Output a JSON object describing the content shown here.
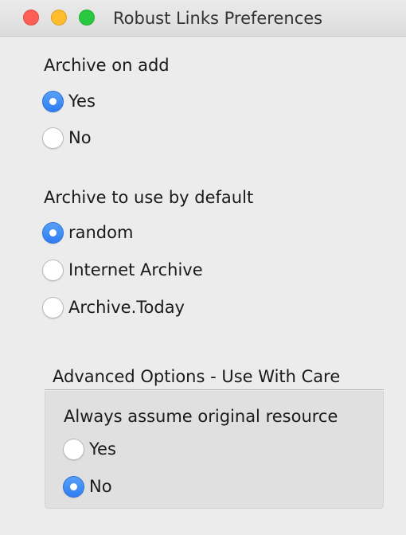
{
  "window": {
    "title": "Robust Links Preferences"
  },
  "archive_on_add": {
    "label": "Archive on add",
    "options": [
      {
        "label": "Yes",
        "checked": true
      },
      {
        "label": "No",
        "checked": false
      }
    ]
  },
  "default_archive": {
    "label": "Archive to use by default",
    "options": [
      {
        "label": "random",
        "checked": true
      },
      {
        "label": "Internet Archive",
        "checked": false
      },
      {
        "label": "Archive.Today",
        "checked": false
      }
    ]
  },
  "advanced": {
    "header": "Advanced Options - Use With Care",
    "original_resource": {
      "label": "Always assume original resource",
      "options": [
        {
          "label": "Yes",
          "checked": false
        },
        {
          "label": "No",
          "checked": true
        }
      ]
    }
  },
  "colors": {
    "accent": "#2f7ef2",
    "window_bg": "#ececec",
    "group_bg": "#e0e0e0",
    "close": "#fd5f57",
    "minimize": "#febc2e",
    "maximize": "#28c840"
  }
}
